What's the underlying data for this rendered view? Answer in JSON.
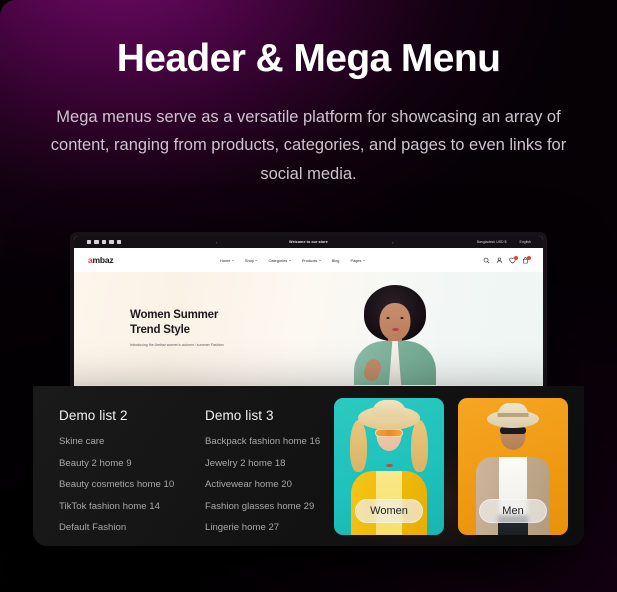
{
  "hero": {
    "title": "Header & Mega Menu",
    "subtitle": "Mega menus serve as a versatile platform for showcasing an array of content, ranging from products, categories, and pages to even links for social media."
  },
  "browser_mockup": {
    "topbar": {
      "announcement": "Welcome to our store",
      "prev_arrow": "‹",
      "next_arrow": "›",
      "arrow_after_announce": "→",
      "currency": "Bangladesh USD $",
      "currency_caret": "∨",
      "language": "English",
      "language_caret": "∨",
      "social_icons": [
        "tiktok-icon",
        "instagram-icon",
        "youtube-icon",
        "twitter-icon",
        "facebook-icon"
      ]
    },
    "header": {
      "logo": "ambaz",
      "nav": [
        {
          "label": "Home",
          "has_caret": true
        },
        {
          "label": "Shop",
          "has_caret": true
        },
        {
          "label": "Categories",
          "has_caret": true
        },
        {
          "label": "Products",
          "has_caret": true
        },
        {
          "label": "Blog",
          "has_caret": false
        },
        {
          "label": "Pages",
          "has_caret": true
        }
      ],
      "actions": [
        {
          "icon": "search-icon",
          "badge": false
        },
        {
          "icon": "user-account-icon",
          "badge": false
        },
        {
          "icon": "wishlist-heart-icon",
          "badge": true
        },
        {
          "icon": "shopping-bag-icon",
          "badge": true
        }
      ]
    },
    "hero_banner": {
      "title_line1": "Women Summer",
      "title_line2": "Trend Style",
      "subtitle": "Introducing the Ambaz women's autumn / summer Fashion"
    }
  },
  "mega_menu": {
    "columns": [
      {
        "title": "Demo list 2",
        "links": [
          "Skine care",
          "Beauty 2 home 9",
          "Beauty cosmetics home 10",
          "TikTok fashion home 14",
          "Default Fashion"
        ]
      },
      {
        "title": "Demo list 3",
        "links": [
          "Backpack fashion home 16",
          "Jewelry 2 home 18",
          "Activewear home 20",
          "Fashion glasses home 29",
          "Lingerie home 27"
        ]
      }
    ],
    "promo_cards": [
      {
        "label": "Women",
        "background_color": "#1fc2bc"
      },
      {
        "label": "Men",
        "background_color": "#f5a623"
      }
    ]
  },
  "colors": {
    "accent_purple": "#6e0a66",
    "page_background": "#050105",
    "panel_background": "#141414",
    "brand_red": "#e8422e",
    "heading_white": "#ffffff",
    "subtitle_grey": "#cfc3cf",
    "menu_link_grey": "#a8a8a8"
  }
}
